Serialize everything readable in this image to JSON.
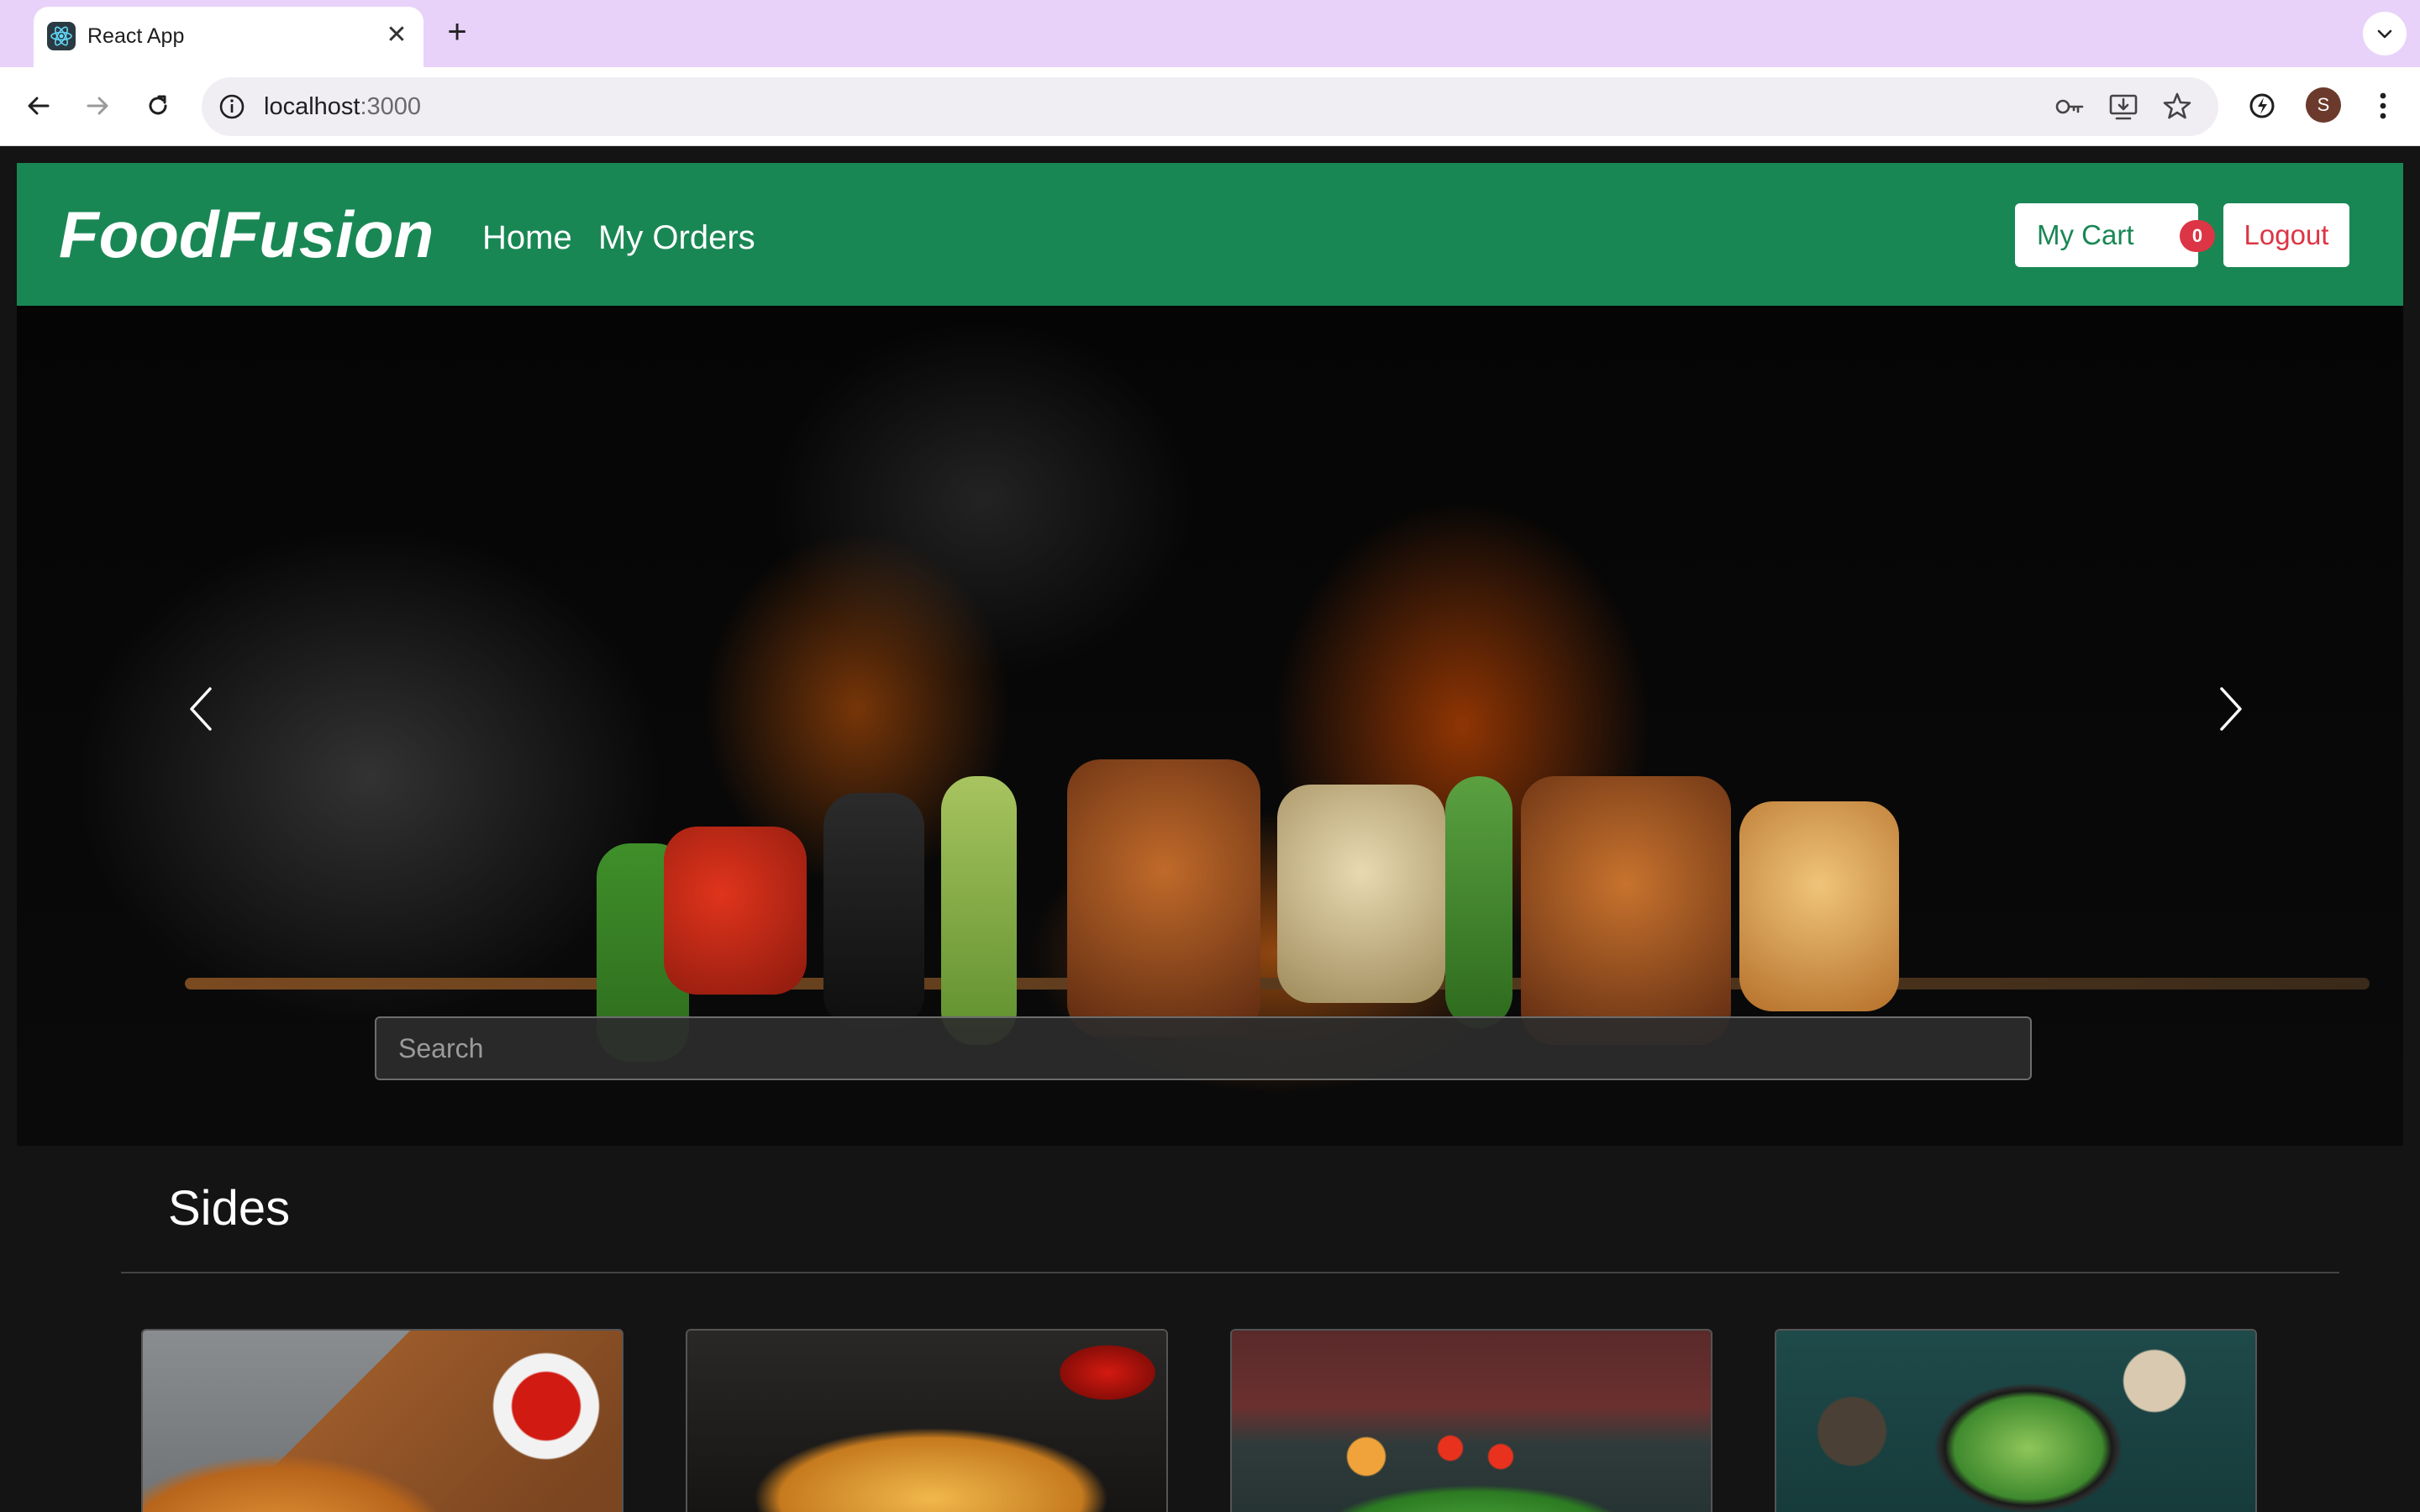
{
  "browser": {
    "tab_title": "React App",
    "tab_close_glyph": "✕",
    "newtab_glyph": "+",
    "url_host": "localhost",
    "url_port": ":3000",
    "profile_initial": "S"
  },
  "navbar": {
    "brand": "FoodFusion",
    "links": [
      "Home",
      "My Orders"
    ],
    "cart_label": "My Cart",
    "cart_count": "0",
    "logout_label": "Logout"
  },
  "hero": {
    "search_placeholder": "Search"
  },
  "section": {
    "title": "Sides"
  },
  "cards": [
    {
      "image": "fries-in-paper-with-ketchup"
    },
    {
      "image": "french-fries-plate-with-ketchup"
    },
    {
      "image": "pizza-with-tomatoes"
    },
    {
      "image": "greek-salad-bowl"
    }
  ],
  "colors": {
    "navbar": "#198754",
    "danger": "#dc3545",
    "background": "#141414",
    "tabstrip": "#e8d2f9"
  }
}
